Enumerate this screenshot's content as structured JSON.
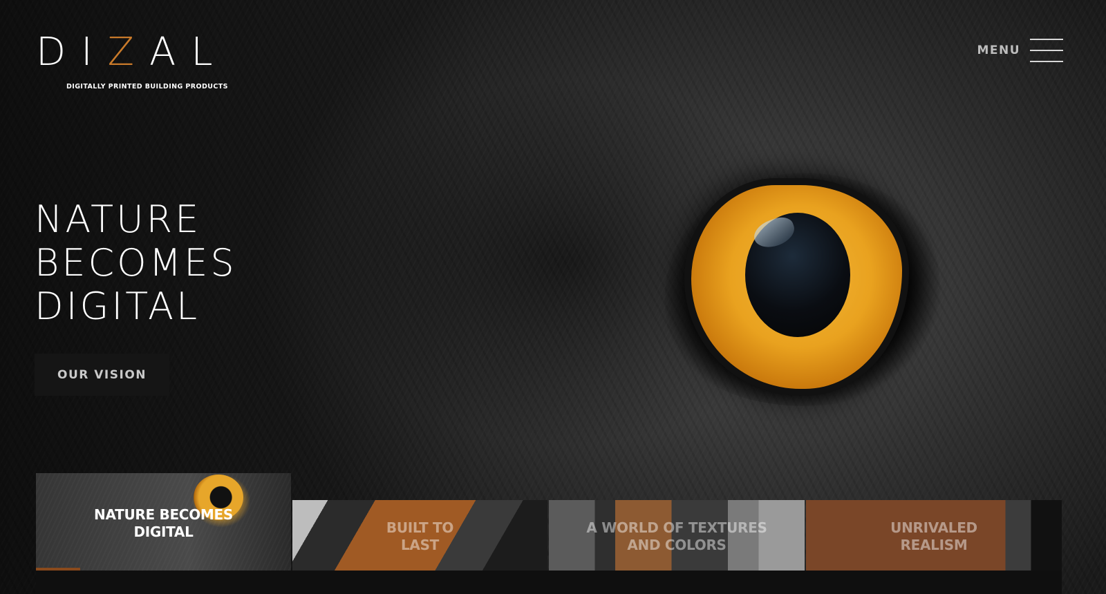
{
  "brand": {
    "letters": [
      "D",
      "I",
      "Z",
      "A",
      "L"
    ],
    "tagline": "DIGITALLY PRINTED BUILDING PRODUCTS",
    "accent_color": "#c97a2a"
  },
  "nav": {
    "menu_label": "MENU",
    "menu_icon": "hamburger-icon"
  },
  "hero": {
    "headline_lines": [
      "NATURE",
      "BECOMES",
      "DIGITAL"
    ],
    "cta_label": "OUR VISION"
  },
  "tiles": [
    {
      "label_lines": [
        "NATURE BECOMES",
        "DIGITAL"
      ],
      "active": true
    },
    {
      "label_lines": [
        "BUILT TO",
        "LAST"
      ],
      "active": false
    },
    {
      "label_lines": [
        "A WORLD OF TEXTURES",
        "AND COLORS"
      ],
      "active": false
    },
    {
      "label_lines": [
        "UNRIVALED",
        "REALISM"
      ],
      "active": false
    }
  ]
}
